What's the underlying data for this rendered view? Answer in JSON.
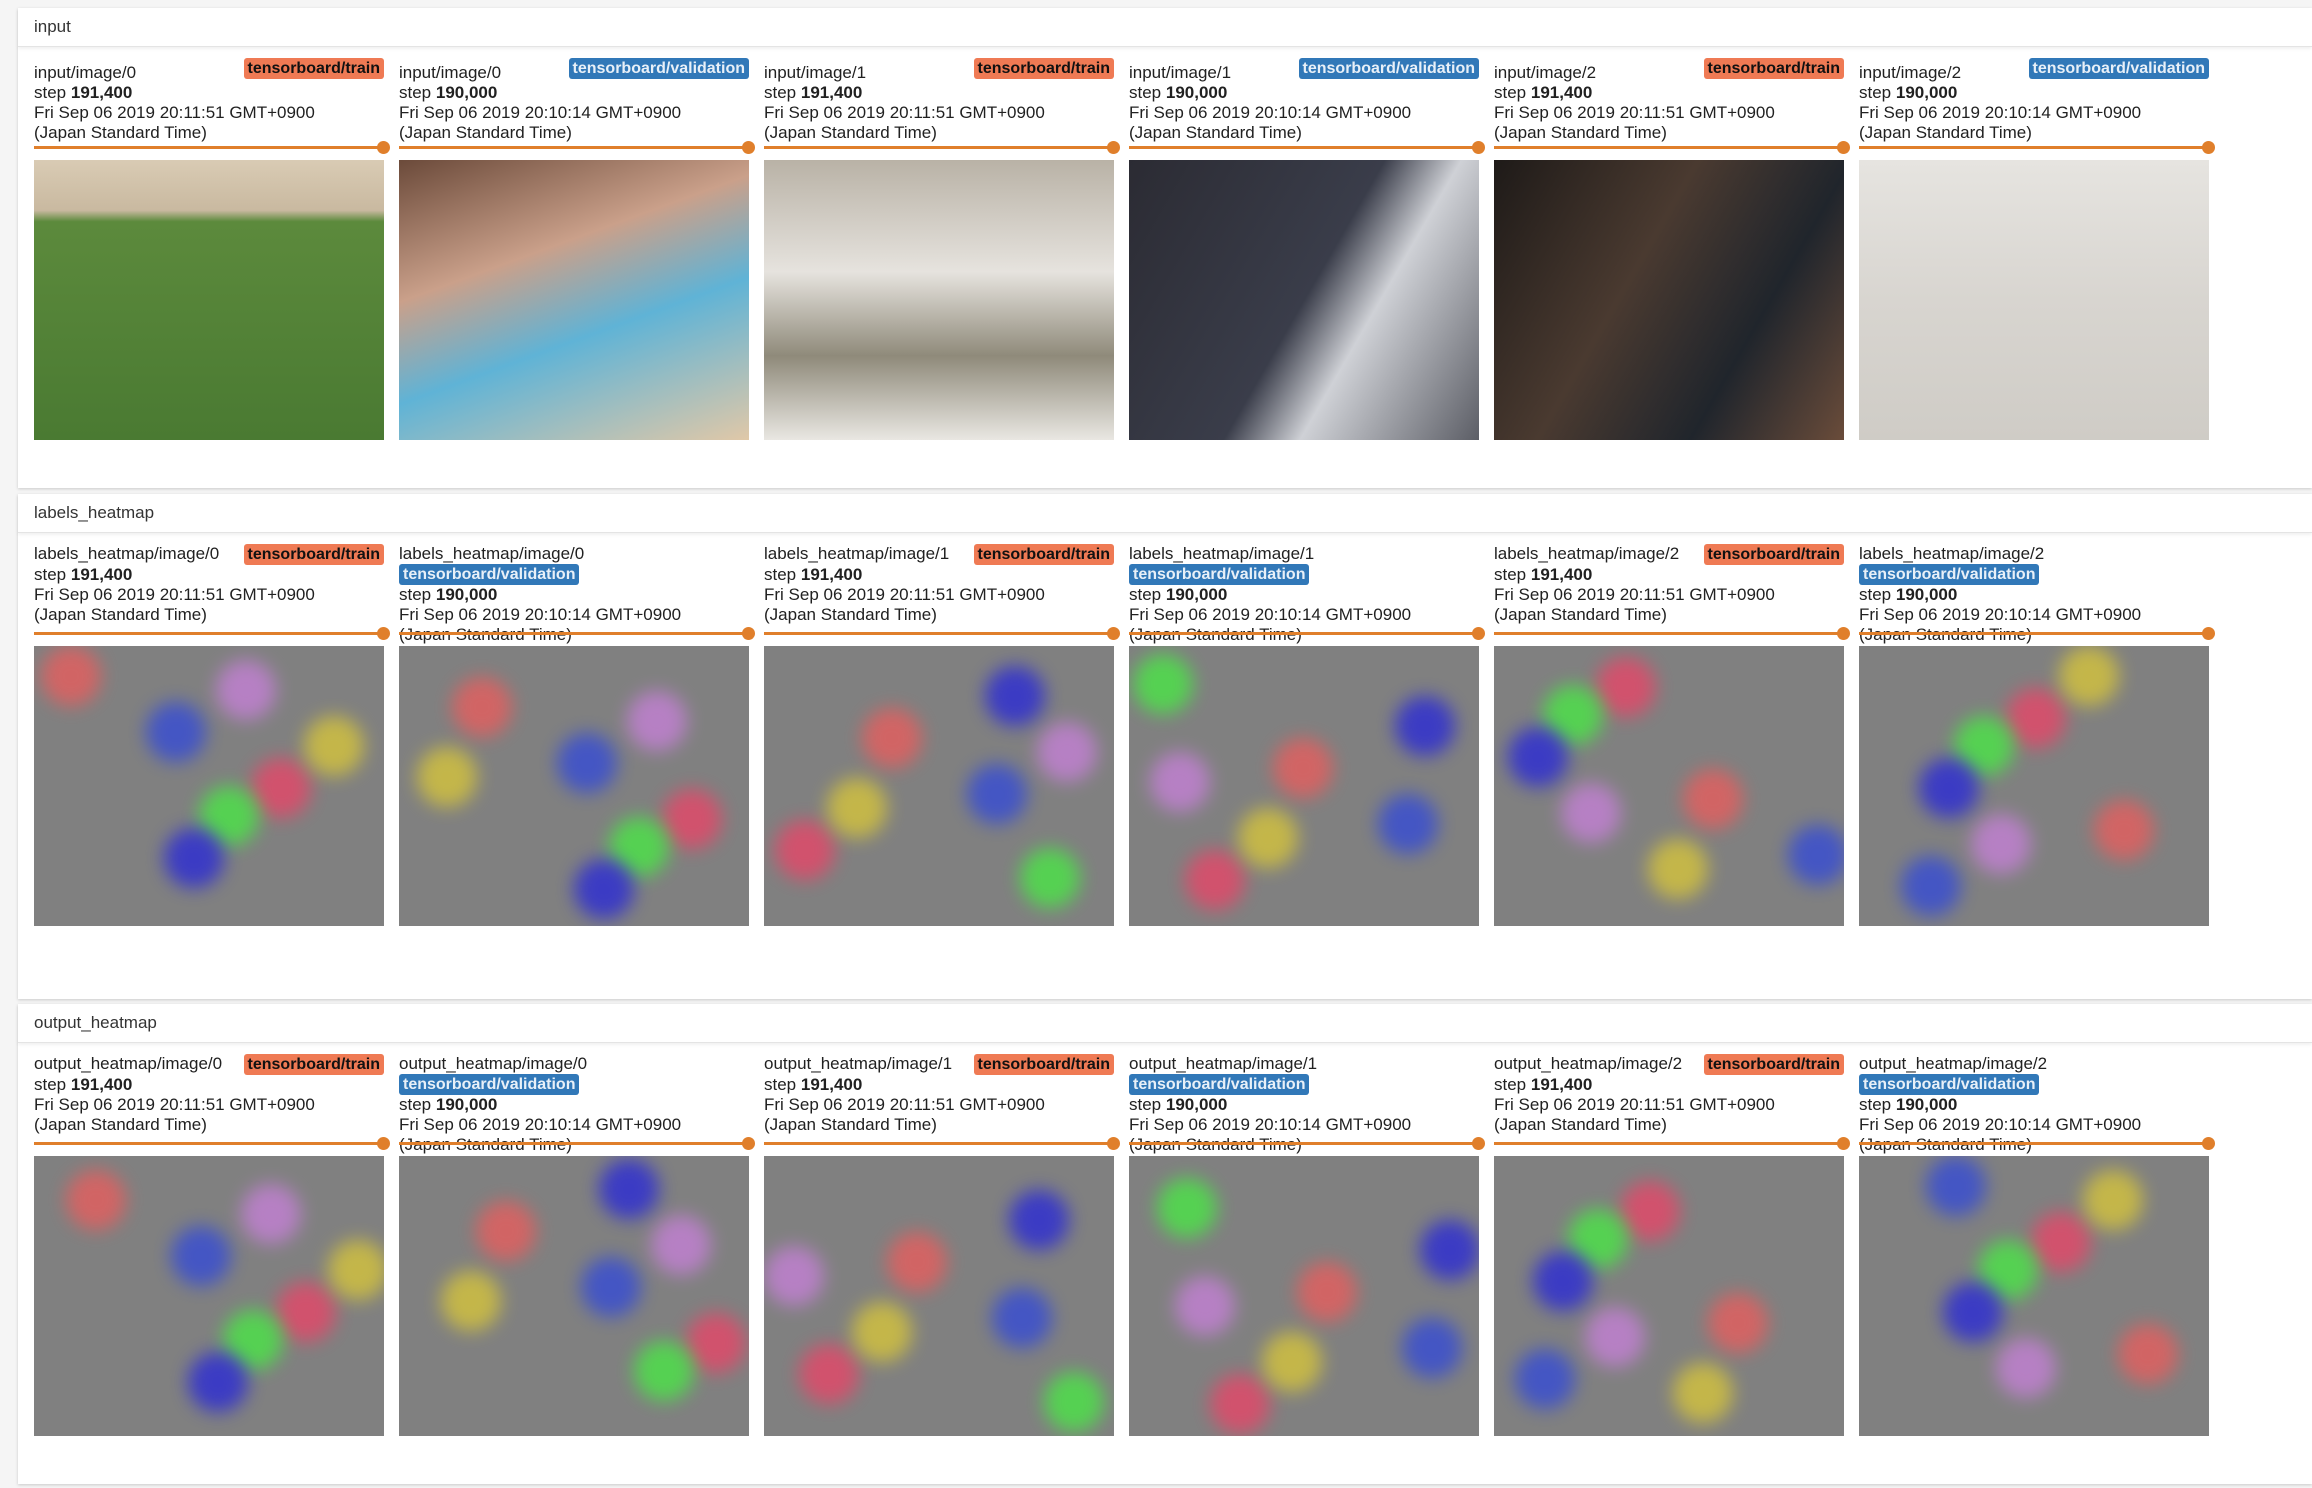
{
  "sections": [
    {
      "title": "input",
      "kind": "photo",
      "cards": [
        {
          "name": "input/image/0",
          "run": "tensorboard/train",
          "run_type": "train",
          "step_label": "step",
          "step": "191,400",
          "time": "Fri Sep 06 2019 20:11:51 GMT+0900",
          "tz": "(Japan Standard Time)"
        },
        {
          "name": "input/image/0",
          "run": "tensorboard/validation",
          "run_type": "validation",
          "step_label": "step",
          "step": "190,000",
          "time": "Fri Sep 06 2019 20:10:14 GMT+0900",
          "tz": "(Japan Standard Time)"
        },
        {
          "name": "input/image/1",
          "run": "tensorboard/train",
          "run_type": "train",
          "step_label": "step",
          "step": "191,400",
          "time": "Fri Sep 06 2019 20:11:51 GMT+0900",
          "tz": "(Japan Standard Time)"
        },
        {
          "name": "input/image/1",
          "run": "tensorboard/validation",
          "run_type": "validation",
          "step_label": "step",
          "step": "190,000",
          "time": "Fri Sep 06 2019 20:10:14 GMT+0900",
          "tz": "(Japan Standard Time)"
        },
        {
          "name": "input/image/2",
          "run": "tensorboard/train",
          "run_type": "train",
          "step_label": "step",
          "step": "191,400",
          "time": "Fri Sep 06 2019 20:11:51 GMT+0900",
          "tz": "(Japan Standard Time)"
        },
        {
          "name": "input/image/2",
          "run": "tensorboard/validation",
          "run_type": "validation",
          "step_label": "step",
          "step": "190,000",
          "time": "Fri Sep 06 2019 20:10:14 GMT+0900",
          "tz": "(Japan Standard Time)"
        }
      ]
    },
    {
      "title": "labels_heatmap",
      "kind": "heat",
      "cards": [
        {
          "name": "labels_heatmap/image/0",
          "run": "tensorboard/train",
          "run_type": "train",
          "step_label": "step",
          "step": "191,400",
          "time": "Fri Sep 06 2019 20:11:51 GMT+0900",
          "tz": "(Japan Standard Time)"
        },
        {
          "name": "labels_heatmap/image/0",
          "run": "tensorboard/validation",
          "run_type": "validation",
          "step_label": "step",
          "step": "190,000",
          "time": "Fri Sep 06 2019 20:10:14 GMT+0900",
          "tz": "(Japan Standard Time)"
        },
        {
          "name": "labels_heatmap/image/1",
          "run": "tensorboard/train",
          "run_type": "train",
          "step_label": "step",
          "step": "191,400",
          "time": "Fri Sep 06 2019 20:11:51 GMT+0900",
          "tz": "(Japan Standard Time)"
        },
        {
          "name": "labels_heatmap/image/1",
          "run": "tensorboard/validation",
          "run_type": "validation",
          "step_label": "step",
          "step": "190,000",
          "time": "Fri Sep 06 2019 20:10:14 GMT+0900",
          "tz": "(Japan Standard Time)"
        },
        {
          "name": "labels_heatmap/image/2",
          "run": "tensorboard/train",
          "run_type": "train",
          "step_label": "step",
          "step": "191,400",
          "time": "Fri Sep 06 2019 20:11:51 GMT+0900",
          "tz": "(Japan Standard Time)"
        },
        {
          "name": "labels_heatmap/image/2",
          "run": "tensorboard/validation",
          "run_type": "validation",
          "step_label": "step",
          "step": "190,000",
          "time": "Fri Sep 06 2019 20:10:14 GMT+0900",
          "tz": "(Japan Standard Time)"
        }
      ]
    },
    {
      "title": "output_heatmap",
      "kind": "heat",
      "cards": [
        {
          "name": "output_heatmap/image/0",
          "run": "tensorboard/train",
          "run_type": "train",
          "step_label": "step",
          "step": "191,400",
          "time": "Fri Sep 06 2019 20:11:51 GMT+0900",
          "tz": "(Japan Standard Time)"
        },
        {
          "name": "output_heatmap/image/0",
          "run": "tensorboard/validation",
          "run_type": "validation",
          "step_label": "step",
          "step": "190,000",
          "time": "Fri Sep 06 2019 20:10:14 GMT+0900",
          "tz": "(Japan Standard Time)"
        },
        {
          "name": "output_heatmap/image/1",
          "run": "tensorboard/train",
          "run_type": "train",
          "step_label": "step",
          "step": "191,400",
          "time": "Fri Sep 06 2019 20:11:51 GMT+0900",
          "tz": "(Japan Standard Time)"
        },
        {
          "name": "output_heatmap/image/1",
          "run": "tensorboard/validation",
          "run_type": "validation",
          "step_label": "step",
          "step": "190,000",
          "time": "Fri Sep 06 2019 20:10:14 GMT+0900",
          "tz": "(Japan Standard Time)"
        },
        {
          "name": "output_heatmap/image/2",
          "run": "tensorboard/train",
          "run_type": "train",
          "step_label": "step",
          "step": "191,400",
          "time": "Fri Sep 06 2019 20:11:51 GMT+0900",
          "tz": "(Japan Standard Time)"
        },
        {
          "name": "output_heatmap/image/2",
          "run": "tensorboard/validation",
          "run_type": "validation",
          "step_label": "step",
          "step": "190,000",
          "time": "Fri Sep 06 2019 20:10:14 GMT+0900",
          "tz": "(Japan Standard Time)"
        }
      ]
    }
  ],
  "colors": {
    "train": "#ef7a54",
    "validation": "#3178b8",
    "slider": "#e07f2b",
    "heatmap_bg": "#808080"
  }
}
